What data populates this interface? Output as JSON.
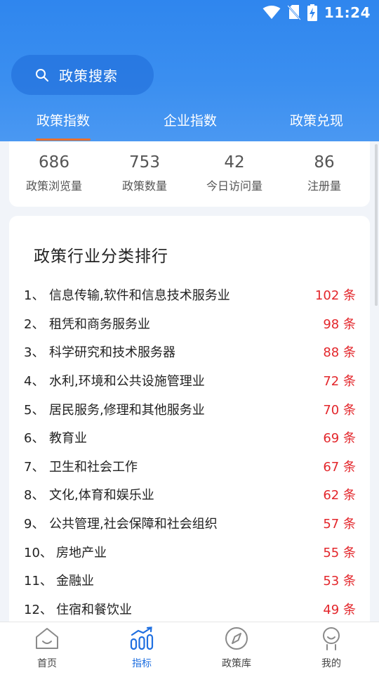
{
  "status": {
    "time": "11:24"
  },
  "search": {
    "label": "政策搜索"
  },
  "tabs": [
    {
      "label": "政策指数",
      "active": true
    },
    {
      "label": "企业指数",
      "active": false
    },
    {
      "label": "政策兑现",
      "active": false
    }
  ],
  "stats": [
    {
      "value": "686",
      "label": "政策浏览量"
    },
    {
      "value": "753",
      "label": "政策数量"
    },
    {
      "value": "42",
      "label": "今日访问量"
    },
    {
      "value": "86",
      "label": "注册量"
    }
  ],
  "ranking": {
    "title": "政策行业分类排行",
    "items": [
      {
        "num": "1、",
        "name": "信息传输,软件和信息技术服务业",
        "count": "102 条"
      },
      {
        "num": "2、",
        "name": "租凭和商务服务业",
        "count": "98 条"
      },
      {
        "num": "3、",
        "name": "科学研究和技术服务器",
        "count": "88 条"
      },
      {
        "num": "4、",
        "name": "水利,环境和公共设施管理业",
        "count": "72 条"
      },
      {
        "num": "5、",
        "name": "居民服务,修理和其他服务业",
        "count": "70 条"
      },
      {
        "num": "6、",
        "name": "教育业",
        "count": "69 条"
      },
      {
        "num": "7、",
        "name": "卫生和社会工作",
        "count": "67 条"
      },
      {
        "num": "8、",
        "name": "文化,体育和娱乐业",
        "count": "62 条"
      },
      {
        "num": "9、",
        "name": "公共管理,社会保障和社会组织",
        "count": "57 条"
      },
      {
        "num": "10、",
        "name": "房地产业",
        "count": "55 条"
      },
      {
        "num": "11、",
        "name": "金融业",
        "count": "53 条"
      },
      {
        "num": "12、",
        "name": "住宿和餐饮业",
        "count": "49 条"
      }
    ]
  },
  "nav": [
    {
      "label": "首页",
      "icon": "home-icon",
      "active": false
    },
    {
      "label": "指标",
      "icon": "chart-icon",
      "active": true
    },
    {
      "label": "政策库",
      "icon": "compass-icon",
      "active": false
    },
    {
      "label": "我的",
      "icon": "person-icon",
      "active": false
    }
  ],
  "colors": {
    "header": "#2f86ee",
    "accent": "#e9702c",
    "count": "#e3262b",
    "navActive": "#1f6fe0"
  }
}
